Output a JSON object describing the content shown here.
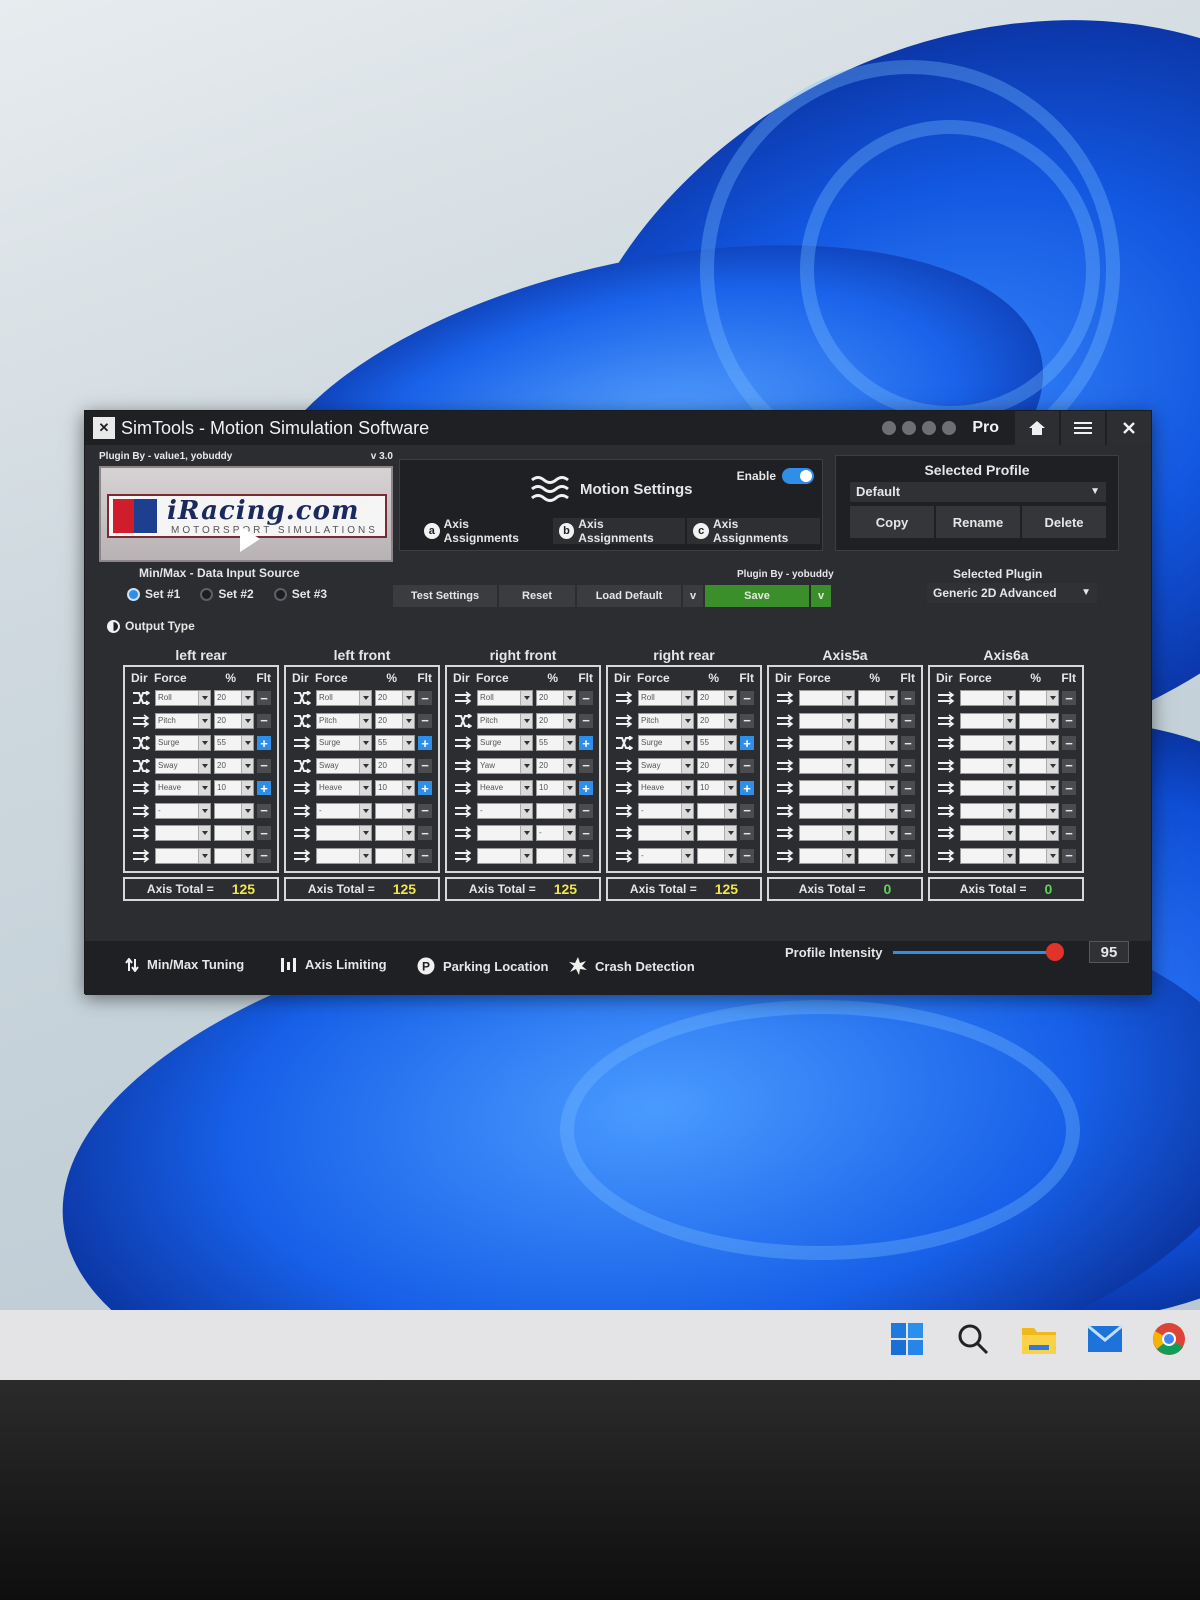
{
  "window": {
    "title": "SimTools - Motion Simulation Software",
    "edition": "Pro"
  },
  "plugin_box": {
    "by": "Plugin By - value1, yobuddy",
    "version": "v 3.0",
    "brand": "iRacing.com",
    "brand_sub": "MOTORSPORT SIMULATIONS"
  },
  "motion": {
    "title": "Motion Settings",
    "enable_label": "Enable",
    "tabs": [
      {
        "letter": "a",
        "label": "Axis Assignments"
      },
      {
        "letter": "b",
        "label": "Axis Assignments"
      },
      {
        "letter": "c",
        "label": "Axis Assignments"
      }
    ]
  },
  "profile": {
    "title": "Selected Profile",
    "value": "Default",
    "buttons": [
      "Copy",
      "Rename",
      "Delete"
    ]
  },
  "data_source": {
    "label": "Min/Max - Data Input Source",
    "sets": [
      "Set #1",
      "Set #2",
      "Set #3"
    ],
    "selected": 0,
    "output_type": "Output Type"
  },
  "actions": {
    "plugin_by": "Plugin By - yobuddy",
    "test": "Test Settings",
    "reset": "Reset",
    "load_default": "Load Default",
    "dropdown": "v",
    "save": "Save"
  },
  "selected_plugin": {
    "title": "Selected Plugin",
    "value": "Generic 2D Advanced"
  },
  "columns": {
    "dir": "Dir",
    "force": "Force",
    "pct": "%",
    "flt": "Flt"
  },
  "total_label": "Axis Total =",
  "axes": [
    {
      "name": "left rear",
      "total": "125",
      "rows": [
        {
          "dir": "cross",
          "force": "Roll",
          "pct": "20",
          "flt": "minus"
        },
        {
          "dir": "arrows",
          "force": "Pitch",
          "pct": "20",
          "flt": "minus"
        },
        {
          "dir": "cross",
          "force": "Surge",
          "pct": "55",
          "flt": "plus"
        },
        {
          "dir": "cross",
          "force": "Sway",
          "pct": "20",
          "flt": "minus"
        },
        {
          "dir": "arrows",
          "force": "Heave",
          "pct": "10",
          "flt": "plus"
        },
        {
          "dir": "arrows",
          "force": "-",
          "pct": "",
          "flt": "minus"
        },
        {
          "dir": "arrows",
          "force": "",
          "pct": "",
          "flt": "minus"
        },
        {
          "dir": "arrows",
          "force": "",
          "pct": "",
          "flt": "minus"
        }
      ]
    },
    {
      "name": "left front",
      "total": "125",
      "rows": [
        {
          "dir": "cross",
          "force": "Roll",
          "pct": "20",
          "flt": "minus"
        },
        {
          "dir": "cross",
          "force": "Pitch",
          "pct": "20",
          "flt": "minus"
        },
        {
          "dir": "arrows",
          "force": "Surge",
          "pct": "55",
          "flt": "plus"
        },
        {
          "dir": "cross",
          "force": "Sway",
          "pct": "20",
          "flt": "minus"
        },
        {
          "dir": "arrows",
          "force": "Heave",
          "pct": "10",
          "flt": "plus"
        },
        {
          "dir": "arrows",
          "force": "-",
          "pct": "",
          "flt": "minus"
        },
        {
          "dir": "arrows",
          "force": "",
          "pct": "",
          "flt": "minus"
        },
        {
          "dir": "arrows",
          "force": "",
          "pct": "",
          "flt": "minus"
        }
      ]
    },
    {
      "name": "right front",
      "total": "125",
      "rows": [
        {
          "dir": "arrows",
          "force": "Roll",
          "pct": "20",
          "flt": "minus"
        },
        {
          "dir": "cross",
          "force": "Pitch",
          "pct": "20",
          "flt": "minus"
        },
        {
          "dir": "arrows",
          "force": "Surge",
          "pct": "55",
          "flt": "plus"
        },
        {
          "dir": "arrows",
          "force": "Yaw",
          "pct": "20",
          "flt": "minus"
        },
        {
          "dir": "arrows",
          "force": "Heave",
          "pct": "10",
          "flt": "plus"
        },
        {
          "dir": "arrows",
          "force": "-",
          "pct": "",
          "flt": "minus"
        },
        {
          "dir": "arrows",
          "force": "",
          "pct": "-",
          "flt": "minus"
        },
        {
          "dir": "arrows",
          "force": "",
          "pct": "",
          "flt": "minus"
        }
      ]
    },
    {
      "name": "right rear",
      "total": "125",
      "rows": [
        {
          "dir": "arrows",
          "force": "Roll",
          "pct": "20",
          "flt": "minus"
        },
        {
          "dir": "arrows",
          "force": "Pitch",
          "pct": "20",
          "flt": "minus"
        },
        {
          "dir": "cross",
          "force": "Surge",
          "pct": "55",
          "flt": "plus"
        },
        {
          "dir": "arrows",
          "force": "Sway",
          "pct": "20",
          "flt": "minus"
        },
        {
          "dir": "arrows",
          "force": "Heave",
          "pct": "10",
          "flt": "plus"
        },
        {
          "dir": "arrows",
          "force": "-",
          "pct": "",
          "flt": "minus"
        },
        {
          "dir": "arrows",
          "force": "",
          "pct": "",
          "flt": "minus"
        },
        {
          "dir": "arrows",
          "force": "-",
          "pct": "",
          "flt": "minus"
        }
      ]
    },
    {
      "name": "Axis5a",
      "total": "0",
      "rows": [
        {
          "dir": "arrows",
          "force": "",
          "pct": "",
          "flt": "minus"
        },
        {
          "dir": "arrows",
          "force": "",
          "pct": "",
          "flt": "minus"
        },
        {
          "dir": "arrows",
          "force": "",
          "pct": "",
          "flt": "minus"
        },
        {
          "dir": "arrows",
          "force": "",
          "pct": "",
          "flt": "minus"
        },
        {
          "dir": "arrows",
          "force": "",
          "pct": "",
          "flt": "minus"
        },
        {
          "dir": "arrows",
          "force": "",
          "pct": "",
          "flt": "minus"
        },
        {
          "dir": "arrows",
          "force": "",
          "pct": "",
          "flt": "minus"
        },
        {
          "dir": "arrows",
          "force": "",
          "pct": "",
          "flt": "minus"
        }
      ]
    },
    {
      "name": "Axis6a",
      "total": "0",
      "rows": [
        {
          "dir": "arrows",
          "force": "",
          "pct": "",
          "flt": "minus"
        },
        {
          "dir": "arrows",
          "force": "",
          "pct": "",
          "flt": "minus"
        },
        {
          "dir": "arrows",
          "force": "",
          "pct": "",
          "flt": "minus"
        },
        {
          "dir": "arrows",
          "force": "",
          "pct": "",
          "flt": "minus"
        },
        {
          "dir": "arrows",
          "force": "",
          "pct": "",
          "flt": "minus"
        },
        {
          "dir": "arrows",
          "force": "",
          "pct": "",
          "flt": "minus"
        },
        {
          "dir": "arrows",
          "force": "",
          "pct": "",
          "flt": "minus"
        },
        {
          "dir": "arrows",
          "force": "",
          "pct": "",
          "flt": "minus"
        }
      ]
    }
  ],
  "bottom": {
    "minmax": "Min/Max Tuning",
    "limiting": "Axis Limiting",
    "parking": "Parking Location",
    "crash": "Crash Detection",
    "intensity_label": "Profile Intensity",
    "intensity": 95,
    "intensity_max": 100
  },
  "colors": {
    "accent": "#2f8ee8",
    "save": "#3b8f2a",
    "total_active": "#f4e64a",
    "total_zero": "#5ed35a"
  }
}
